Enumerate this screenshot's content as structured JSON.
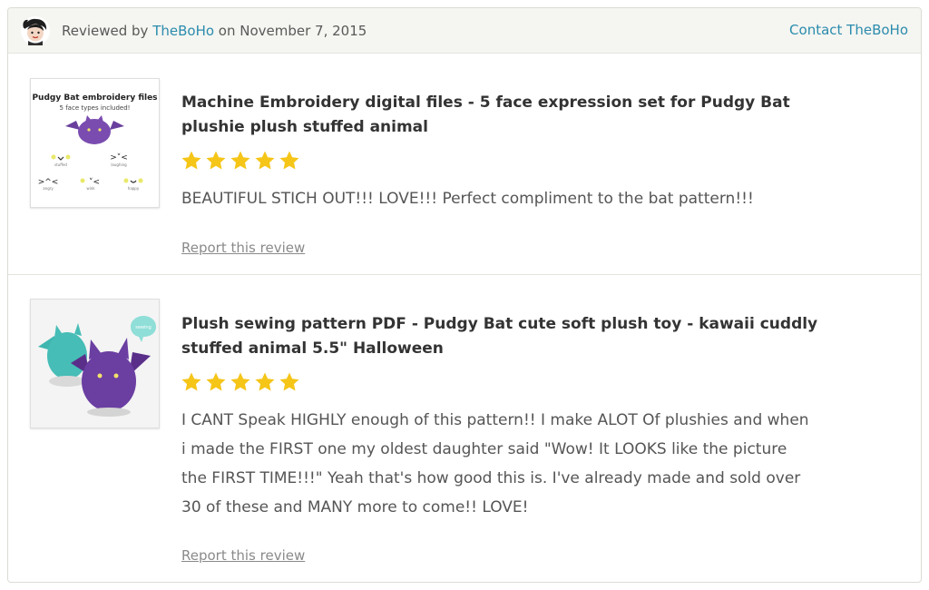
{
  "header": {
    "reviewed_prefix": "Reviewed by ",
    "reviewer_name": "TheBoHo",
    "reviewed_date_text": " on November 7, 2015",
    "contact_label": "Contact TheBoHo",
    "avatar_icon": "reviewer-avatar"
  },
  "reviews": [
    {
      "listing_title": "Machine Embroidery digital files - 5 face expression set for Pudgy Bat plushie plush stuffed animal",
      "rating": 5,
      "max_rating": 5,
      "text": "BEAUTIFUL STICH OUT!!! LOVE!!! Perfect compliment to the bat pattern!!!",
      "report_label": "Report this review",
      "thumb": {
        "title": "Pudgy Bat embroidery files",
        "subtitle": "5 face types included!"
      }
    },
    {
      "listing_title": "Plush sewing pattern PDF - Pudgy Bat cute soft plush toy - kawaii cuddly stuffed animal 5.5\" Halloween",
      "rating": 5,
      "max_rating": 5,
      "text": "I CANT Speak HIGHLY enough of this pattern!! I make ALOT Of plushies and when i made the FIRST one my oldest daughter said \"Wow! It LOOKS like the picture the FIRST TIME!!!\" Yeah that's how good this is. I've already made and sold over 30 of these and MANY more to come!! LOVE!",
      "report_label": "Report this review"
    }
  ],
  "colors": {
    "link": "#2b8cad",
    "star": "#f5c518",
    "header_bg": "#f5f5f1",
    "bat_purple": "#6a3f9e",
    "bat_teal": "#3fb6b0"
  }
}
